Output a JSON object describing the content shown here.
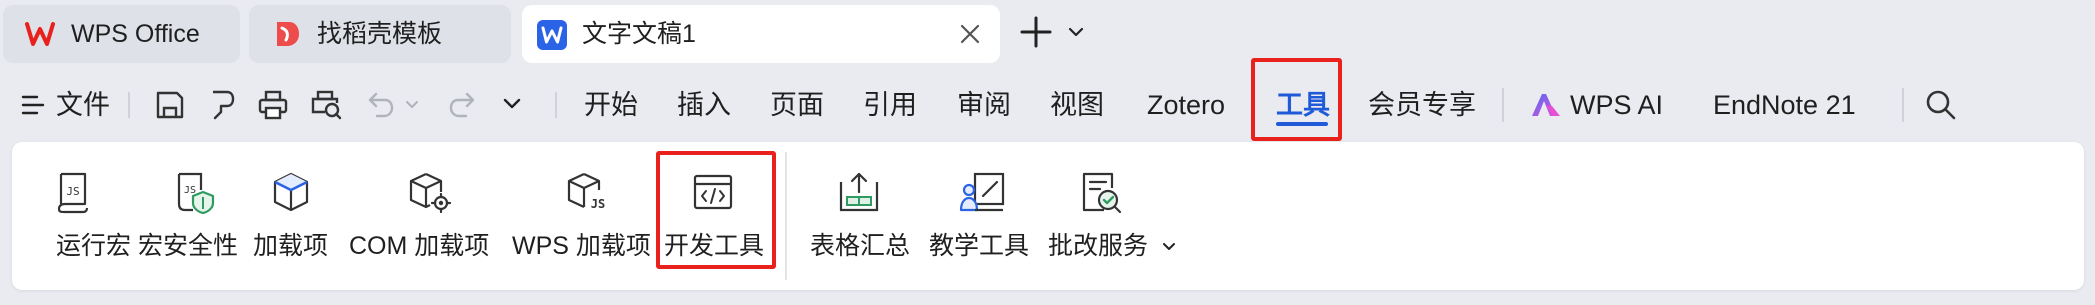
{
  "tabs": [
    {
      "label": "WPS Office",
      "icon": "wps-logo-icon"
    },
    {
      "label": "找稻壳模板",
      "icon": "docer-icon"
    },
    {
      "label": "文字文稿1",
      "icon": "word-doc-icon",
      "active": true
    }
  ],
  "menu": {
    "file_label": "文件",
    "items": [
      "开始",
      "插入",
      "页面",
      "引用",
      "审阅",
      "视图",
      "Zotero",
      "工具",
      "会员专享"
    ],
    "active_item": "工具",
    "wps_ai_label": "WPS AI",
    "endnote_label": "EndNote 21"
  },
  "ribbon": {
    "buttons": [
      {
        "label": "运行宏",
        "icon": "run-macro-icon"
      },
      {
        "label": "宏安全性",
        "icon": "macro-security-icon"
      },
      {
        "label": "加载项",
        "icon": "add-in-icon"
      },
      {
        "label": "COM 加载项",
        "icon": "com-add-in-icon"
      },
      {
        "label": "WPS 加载项",
        "icon": "wps-add-in-icon"
      },
      {
        "label": "开发工具",
        "icon": "developer-tools-icon"
      },
      {
        "label": "表格汇总",
        "icon": "table-summary-icon"
      },
      {
        "label": "教学工具",
        "icon": "teaching-tools-icon"
      },
      {
        "label": "批改服务",
        "icon": "grading-service-icon"
      }
    ]
  },
  "colors": {
    "accent": "#1f5bd8",
    "highlight_box": "#e8211c",
    "wps_red": "#e8211c",
    "word_blue": "#2a63e6"
  }
}
